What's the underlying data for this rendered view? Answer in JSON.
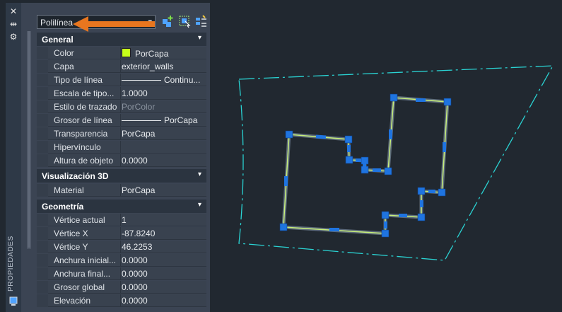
{
  "side_strip": {
    "label": "PROPIEDADES",
    "close_glyph": "✕",
    "autohide_glyph": "⇹",
    "settings_glyph": "⚙"
  },
  "selector": {
    "value": "Polilínea",
    "caret": "▾"
  },
  "toolbar": {
    "icons": [
      "toggle-pickadd-icon",
      "select-objects-icon",
      "quick-select-icon"
    ]
  },
  "sections": {
    "general": {
      "title": "General",
      "chevron": "▾"
    },
    "viz3d": {
      "title": "Visualización 3D",
      "chevron": "▾"
    },
    "geometry": {
      "title": "Geometría",
      "chevron": "▾"
    }
  },
  "general_rows": [
    {
      "key": "Color",
      "value": "PorCapa",
      "swatch": "#c5ff1a"
    },
    {
      "key": "Capa",
      "value": "exterior_walls"
    },
    {
      "key": "Tipo de línea",
      "value": "Continu..."
    },
    {
      "key": "Escala de tipo...",
      "value": "1.0000"
    },
    {
      "key": "Estilo de trazado",
      "value": "PorColor"
    },
    {
      "key": "Grosor de línea",
      "value": "PorCapa"
    },
    {
      "key": "Transparencia",
      "value": "PorCapa"
    },
    {
      "key": "Hipervínculo",
      "value": ""
    },
    {
      "key": "Altura de objeto",
      "value": "0.0000"
    }
  ],
  "viz3d_rows": [
    {
      "key": "Material",
      "value": "PorCapa"
    }
  ],
  "geometry_rows": [
    {
      "key": "Vértice actual",
      "value": "1"
    },
    {
      "key": "Vértice X",
      "value": "-87.8240"
    },
    {
      "key": "Vértice Y",
      "value": "46.2253"
    },
    {
      "key": "Anchura inicial...",
      "value": "0.0000"
    },
    {
      "key": "Anchura final...",
      "value": "0.0000"
    },
    {
      "key": "Grosor global",
      "value": "0.0000"
    },
    {
      "key": "Elevación",
      "value": "0.0000"
    }
  ],
  "colors": {
    "background": "#212830",
    "panel": "#3b4453",
    "accent_arrow": "#e8761f",
    "boundary": "#2ad3d3",
    "polyline": "#c8f07a",
    "grips": "#1f74e0"
  }
}
